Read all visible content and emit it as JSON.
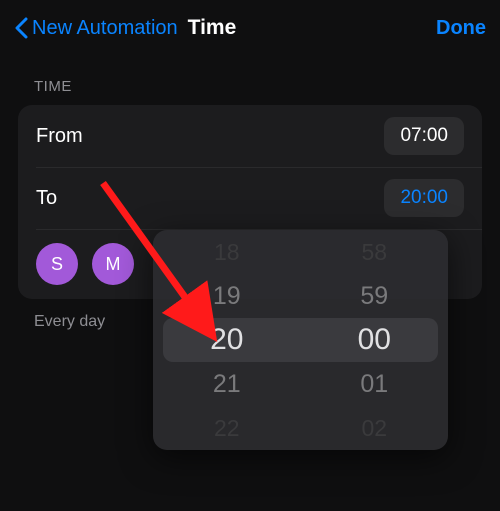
{
  "nav": {
    "back_label": "New Automation",
    "title": "Time",
    "done_label": "Done"
  },
  "section_label": "TIME",
  "rows": {
    "from_label": "From",
    "from_value": "07:00",
    "to_label": "To",
    "to_value": "20:00"
  },
  "days": {
    "visible": [
      "S",
      "M"
    ]
  },
  "footer": "Every day",
  "picker": {
    "hours": {
      "minus2": "18",
      "minus1": "19",
      "selected": "20",
      "plus1": "21",
      "plus2": "22"
    },
    "minutes": {
      "minus2": "58",
      "minus1": "59",
      "selected": "00",
      "plus1": "01",
      "plus2": "02"
    }
  },
  "colors": {
    "accent": "#0a84ff",
    "day_circle": "#a259d9",
    "annotation_arrow": "#ff1a1a"
  }
}
